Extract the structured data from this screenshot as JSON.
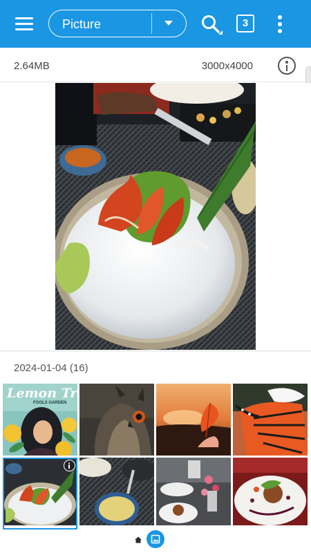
{
  "appbar": {
    "mode_label": "Picture",
    "selected_count": "3",
    "background": "#1a96e3"
  },
  "info": {
    "file_size": "2.64MB",
    "dimensions": "3000x4000"
  },
  "gallery": {
    "date_header": "2024-01-04 (16)",
    "thumbnails": [
      {
        "id": "lemon-tree-poster",
        "text": "Lemon Tr",
        "subtext": "FOOLS GARDEN"
      },
      {
        "id": "owl"
      },
      {
        "id": "sunset-leaf"
      },
      {
        "id": "butterfly"
      },
      {
        "id": "sashimi-plate",
        "selected": true
      },
      {
        "id": "dining-table-soup"
      },
      {
        "id": "restaurant-kitchen"
      },
      {
        "id": "plated-dish"
      }
    ]
  },
  "icons": {
    "menu": "menu-icon",
    "dropdown": "chevron-down-icon",
    "search": "search-icon",
    "count": "selection-count-icon",
    "more": "more-vert-icon",
    "info": "info-icon",
    "home": "home-icon",
    "gallery": "gallery-icon"
  }
}
